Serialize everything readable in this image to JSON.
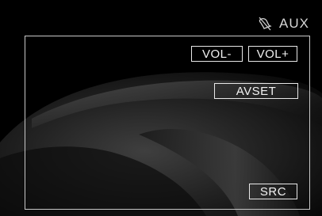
{
  "status": {
    "icon": "mute-icon",
    "source": "AUX"
  },
  "controls": {
    "vol_down_label": "VOL-",
    "vol_up_label": "VOL+",
    "avset_label": "AVSET",
    "src_label": "SRC"
  },
  "colors": {
    "background": "#000000",
    "frame": "#c9c9c9",
    "text": "#f2f2f2"
  }
}
